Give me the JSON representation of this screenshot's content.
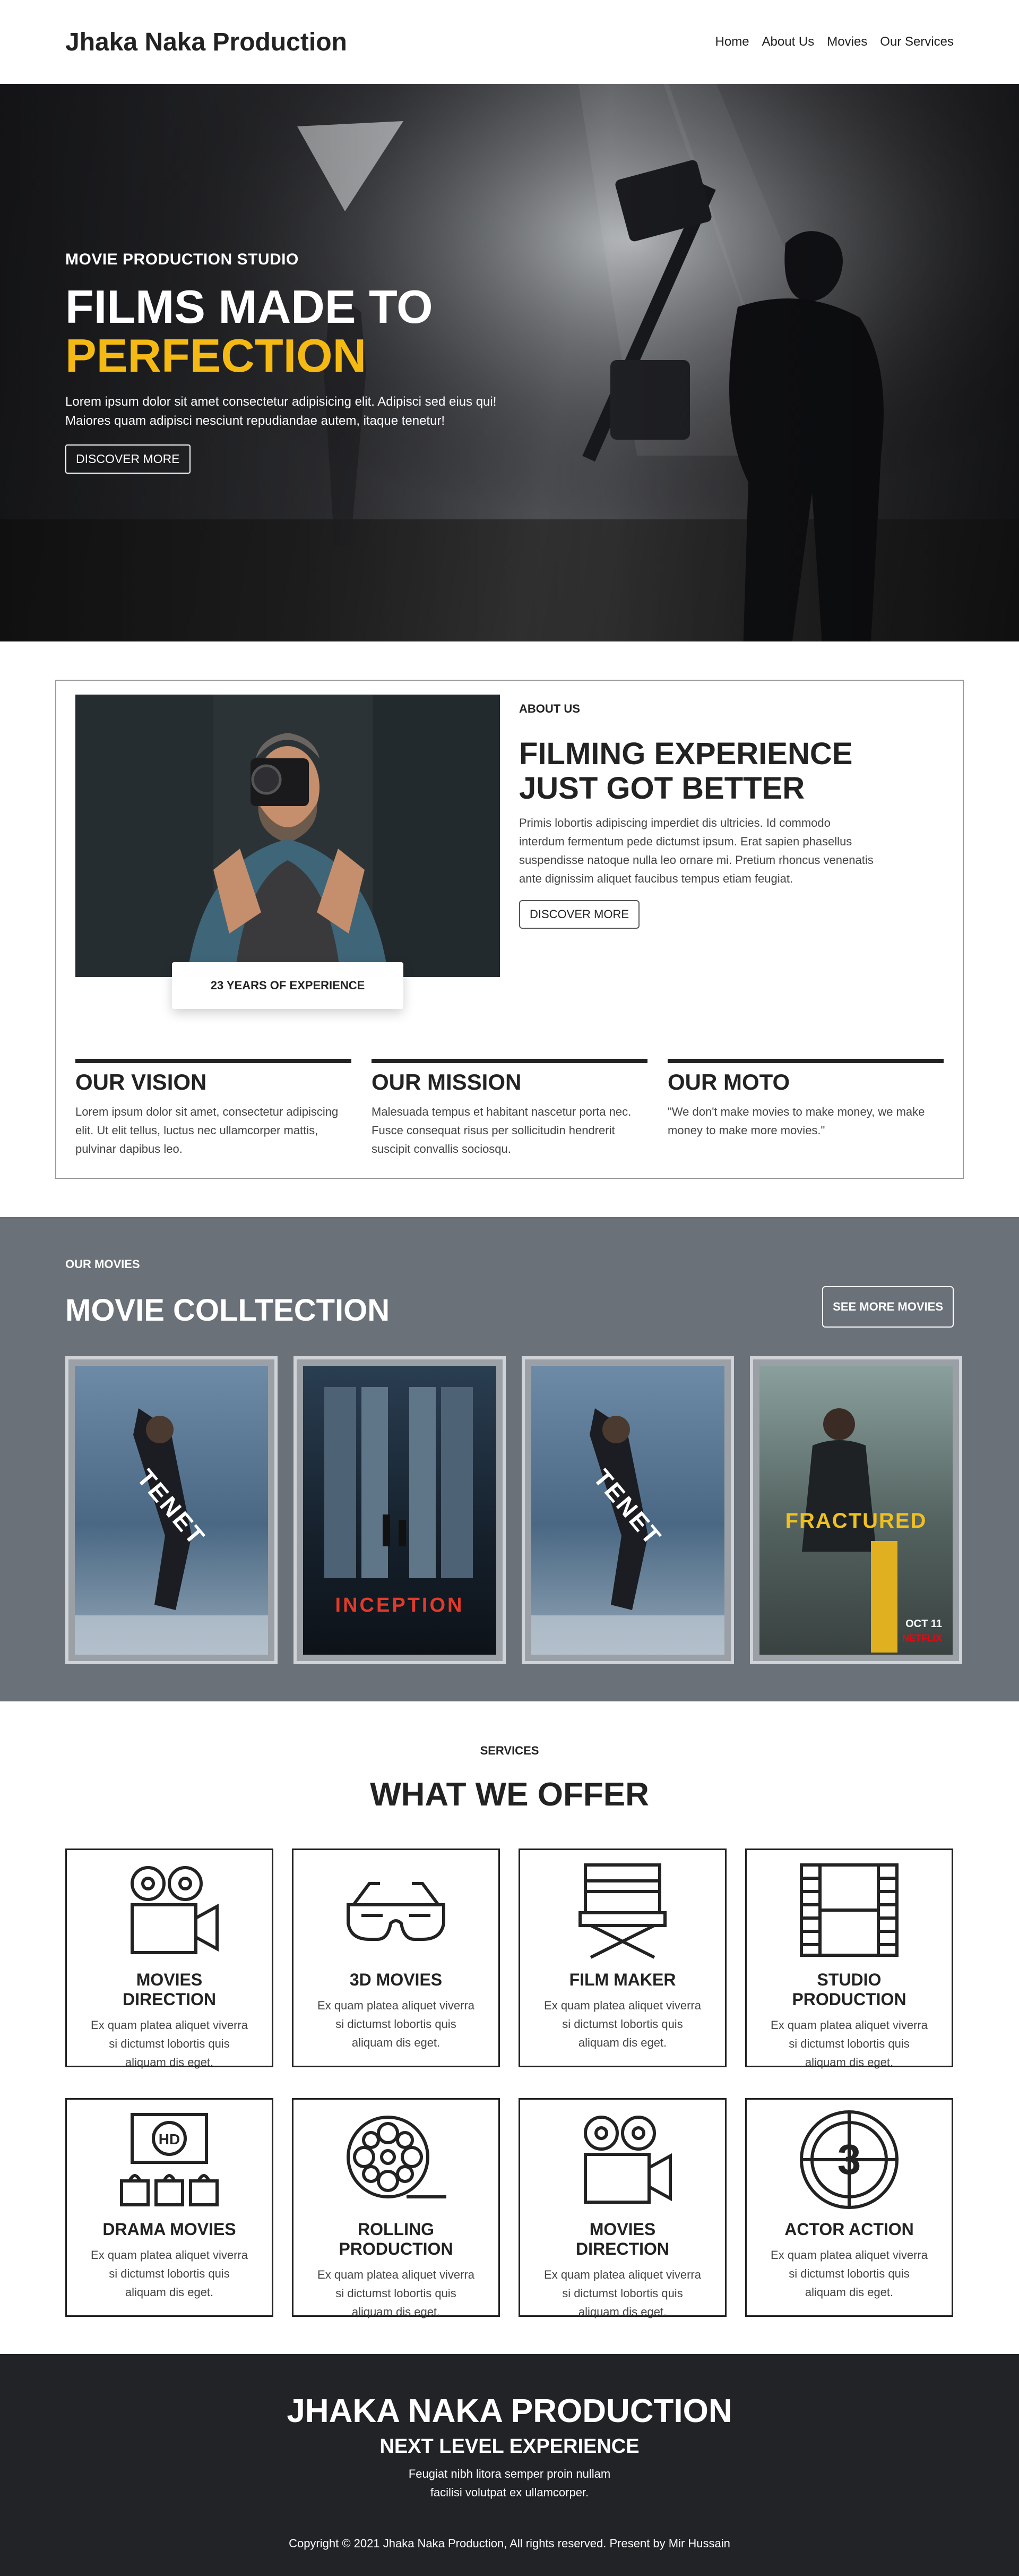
{
  "nav": {
    "brand": "Jhaka Naka Production",
    "links": [
      "Home",
      "About Us",
      "Movies",
      "Our Services"
    ]
  },
  "hero": {
    "kicker": "MOVIE PRODUCTION STUDIO",
    "title_line1": "FILMS MADE TO",
    "title_line2": "PERFECTION",
    "text": "Lorem ipsum dolor sit amet consectetur adipisicing elit. Adipisci sed eius qui! Maiores quam adipisci nesciunt repudiandae autem, itaque tenetur!",
    "button": "DISCOVER MORE",
    "accent_color": "#f5b914"
  },
  "about": {
    "experience_badge": "23 YEARS OF EXPERIENCE",
    "kicker": "ABOUT US",
    "title": "FILMING EXPERIENCE JUST GOT BETTER",
    "body": "Primis lobortis adipiscing imperdiet dis ultricies. Id commodo interdum fermentum pede dictumst ipsum. Erat sapien phasellus suspendisse natoque nulla leo ornare mi. Pretium rhoncus venenatis ante dignissim aliquet faucibus tempus etiam feugiat.",
    "button": "DISCOVER MORE",
    "columns": [
      {
        "title": "OUR VISION",
        "text": "Lorem ipsum dolor sit amet, consectetur adipiscing elit. Ut elit tellus, luctus nec ullamcorper mattis, pulvinar dapibus leo."
      },
      {
        "title": "OUR MISSION",
        "text": "Malesuada tempus et habitant nascetur porta nec. Fusce consequat risus per sollicitudin hendrerit suscipit convallis sociosqu."
      },
      {
        "title": "OUR MOTO",
        "text": "\"We don't make movies to make money, we make money to make more movies.\""
      }
    ]
  },
  "movies": {
    "kicker": "OUR MOVIES",
    "title": "MOVIE COLLTECTION",
    "button": "SEE MORE MOVIES",
    "posters": [
      {
        "title": "TENET",
        "theme": "#5f7f9c"
      },
      {
        "title": "INCEPTION",
        "theme": "#20303f"
      },
      {
        "title": "TENET",
        "theme": "#5f7f9c"
      },
      {
        "title": "FRACTURED",
        "theme": "#4b5956",
        "badge_date": "OCT 11",
        "badge_brand": "NETFLIX"
      }
    ]
  },
  "services": {
    "kicker": "SERVICES",
    "title": "WHAT WE OFFER",
    "items": [
      {
        "name": "MOVIES DIRECTION",
        "icon": "movie-camera-icon",
        "desc": "Ex quam platea aliquet viverra si dictumst lobortis quis aliquam dis eget."
      },
      {
        "name": "3D MOVIES",
        "icon": "3d-glasses-icon",
        "desc": "Ex quam platea aliquet viverra si dictumst lobortis quis aliquam dis eget."
      },
      {
        "name": "FILM MAKER",
        "icon": "director-chair-icon",
        "desc": "Ex quam platea aliquet viverra si dictumst lobortis quis aliquam dis eget."
      },
      {
        "name": "STUDIO PRODUCTION",
        "icon": "film-strip-icon",
        "desc": "Ex quam platea aliquet viverra si dictumst lobortis quis aliquam dis eget."
      },
      {
        "name": "DRAMA MOVIES",
        "icon": "hd-theater-icon",
        "desc": "Ex quam platea aliquet viverra si dictumst lobortis quis aliquam dis eget."
      },
      {
        "name": "ROLLING PRODUCTION",
        "icon": "film-reel-icon",
        "desc": "Ex quam platea aliquet viverra si dictumst lobortis quis aliquam dis eget."
      },
      {
        "name": "MOVIES DIRECTION",
        "icon": "movie-camera-icon",
        "desc": "Ex quam platea aliquet viverra si dictumst lobortis quis aliquam dis eget."
      },
      {
        "name": "ACTOR ACTION",
        "icon": "countdown-leader-icon",
        "desc": "Ex quam platea aliquet viverra si dictumst lobortis quis aliquam dis eget."
      }
    ],
    "hd_label": "HD",
    "countdown_label": "3"
  },
  "footer": {
    "brand": "JHAKA NAKA PRODUCTION",
    "subtitle": "NEXT LEVEL EXPERIENCE",
    "text": "Feugiat nibh litora semper proin nullam facilisi volutpat ex ullamcorper.",
    "copyright": "Copyright © 2021 Jhaka Naka Production, All rights reserved. Present by Mir Hussain"
  }
}
